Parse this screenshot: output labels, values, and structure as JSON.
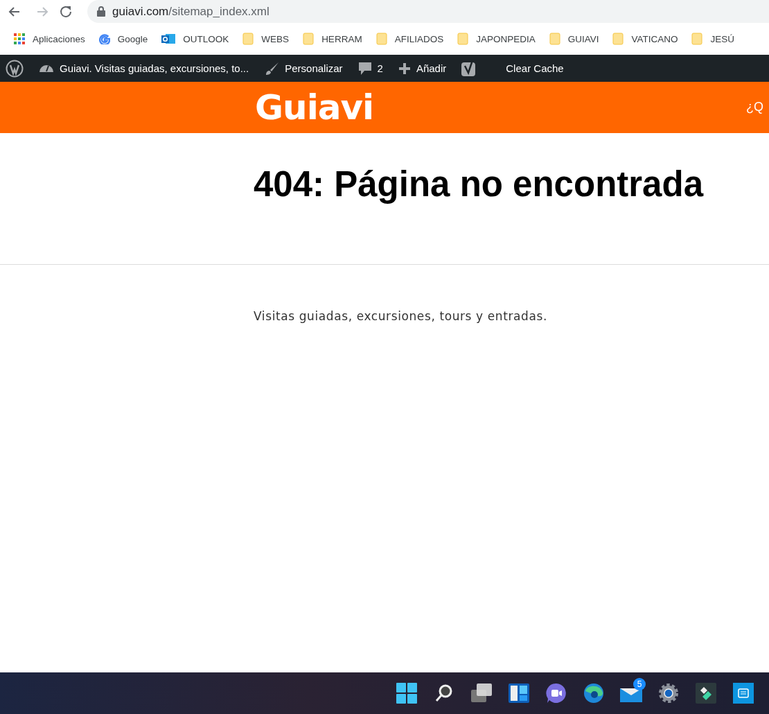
{
  "browser": {
    "url_host": "guiavi.com",
    "url_path": "/sitemap_index.xml"
  },
  "bookmarks": [
    {
      "kind": "apps",
      "label": "Aplicaciones"
    },
    {
      "kind": "google",
      "label": "Google"
    },
    {
      "kind": "outlook",
      "label": "OUTLOOK"
    },
    {
      "kind": "folder",
      "label": "WEBS"
    },
    {
      "kind": "folder",
      "label": "HERRAM"
    },
    {
      "kind": "folder",
      "label": "AFILIADOS"
    },
    {
      "kind": "folder",
      "label": "JAPONPEDIA"
    },
    {
      "kind": "folder",
      "label": "GUIAVI"
    },
    {
      "kind": "folder",
      "label": "VATICANO"
    },
    {
      "kind": "folder",
      "label": "JESÚ"
    }
  ],
  "admin_bar": [
    {
      "kind": "wordpress"
    },
    {
      "kind": "dashboard",
      "label": "Guiavi. Visitas guiadas, excursiones, to..."
    },
    {
      "kind": "brush",
      "label": "Personalizar"
    },
    {
      "kind": "comments",
      "label": "2"
    },
    {
      "kind": "add",
      "label": "Añadir"
    },
    {
      "kind": "yoast"
    },
    {
      "kind": "text",
      "label": "Clear Cache"
    }
  ],
  "site_header": {
    "logo": "Guiavi",
    "nav_item": "¿Q"
  },
  "page": {
    "title": "404: Página no encontrada",
    "tagline": "Visitas guiadas, excursiones, tours y entradas."
  },
  "taskbar": [
    {
      "kind": "start"
    },
    {
      "kind": "search"
    },
    {
      "kind": "task-view"
    },
    {
      "kind": "widgets"
    },
    {
      "kind": "chat"
    },
    {
      "kind": "edge"
    },
    {
      "kind": "mail",
      "badge": "5"
    },
    {
      "kind": "settings"
    },
    {
      "kind": "editor"
    },
    {
      "kind": "printer"
    }
  ]
}
